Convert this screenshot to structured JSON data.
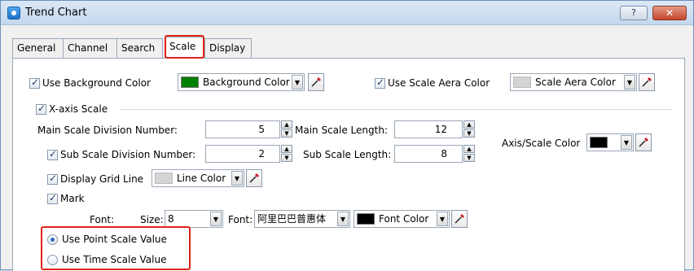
{
  "window": {
    "title": "Trend Chart",
    "help_label": "?",
    "close_label": "✕"
  },
  "tabs": [
    {
      "label": "General"
    },
    {
      "label": "Channel"
    },
    {
      "label": "Search"
    },
    {
      "label": "Scale"
    },
    {
      "label": "Display"
    }
  ],
  "active_tab": "Scale",
  "background": {
    "use_background_color_label": "Use Background Color",
    "use_background_color_checked": true,
    "background_color_label": "Background Color",
    "background_color": "#008000",
    "use_scale_area_color_label": "Use Scale Aera Color",
    "use_scale_area_color_checked": true,
    "scale_area_color_label": "Scale Aera Color",
    "scale_area_color": "#d4d4d4"
  },
  "x_axis": {
    "label": "X-axis Scale",
    "checked": true,
    "main_division_label": "Main Scale Division Number:",
    "main_division_value": "5",
    "main_length_label": "Main Scale Length:",
    "main_length_value": "12",
    "sub_division_label": "Sub Scale Division Number:",
    "sub_division_checked": true,
    "sub_division_value": "2",
    "sub_length_label": "Sub Scale Length:",
    "sub_length_value": "8",
    "axis_color_label": "Axis/Scale Color",
    "axis_color": "#000000",
    "grid_line_label": "Display Grid Line",
    "grid_line_checked": true,
    "line_color_label": "Line Color",
    "line_color": "#d4d4d4",
    "mark_label": "Mark",
    "mark_checked": true,
    "font_label": "Font:",
    "size_label": "Size:",
    "size_value": "8",
    "font_label_2": "Font:",
    "font_value": "阿里巴巴普惠体",
    "font_color_label": "Font Color",
    "font_color": "#000000",
    "point_scale_label": "Use Point Scale Value",
    "point_scale_selected": true,
    "time_scale_label": "Use Time Scale Value",
    "time_scale_selected": false
  },
  "icons": {
    "picker": "eyedropper-icon",
    "spin_up": "spin-up-icon",
    "spin_down": "spin-down-icon",
    "dropdown": "chevron-down-icon"
  },
  "highlight_color": "#e2231a"
}
